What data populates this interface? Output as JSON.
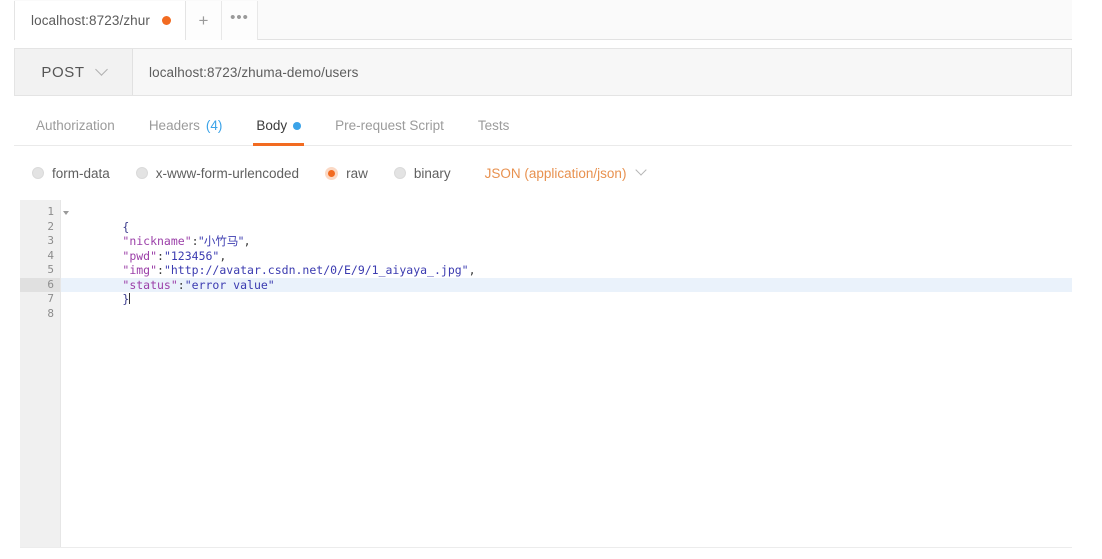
{
  "tabstrip": {
    "request_tab_label": "localhost:8723/zhur",
    "unsaved_indicator": "unsaved-dot",
    "new_tab_glyph": "+",
    "more_glyph": "•••"
  },
  "urlbar": {
    "method": "POST",
    "method_chevron": "chevron-down-icon",
    "url": "localhost:8723/zhuma-demo/users"
  },
  "section_tabs": [
    {
      "label": "Authorization",
      "active": false
    },
    {
      "label": "Headers",
      "count": "(4)",
      "active": false
    },
    {
      "label": "Body",
      "active": true,
      "dot": "blue"
    },
    {
      "label": "Pre-request Script",
      "active": false
    },
    {
      "label": "Tests",
      "active": false
    }
  ],
  "body_types": [
    {
      "label": "form-data",
      "selected": false
    },
    {
      "label": "x-www-form-urlencoded",
      "selected": false
    },
    {
      "label": "raw",
      "selected": true
    },
    {
      "label": "binary",
      "selected": false
    }
  ],
  "mime": {
    "label": "JSON (application/json)",
    "chevron": "chevron-down-icon"
  },
  "editor": {
    "gutter": [
      "1",
      "2",
      "3",
      "4",
      "5",
      "6",
      "7",
      "8"
    ],
    "active_line": 6,
    "lines": [
      {
        "n": 1,
        "open": "{"
      },
      {
        "n": 2,
        "key": "\"nickname\"",
        "colon": ":",
        "value": "\"小竹马\"",
        "comma": ","
      },
      {
        "n": 3,
        "key": "\"pwd\"",
        "colon": ":",
        "value": "\"123456\"",
        "comma": ","
      },
      {
        "n": 4,
        "key": "\"img\"",
        "colon": ":",
        "value": "\"http://avatar.csdn.net/0/E/9/1_aiyaya_.jpg\"",
        "comma": ","
      },
      {
        "n": 5,
        "key": "\"status\"",
        "colon": ":",
        "value": "\"error value\"",
        "comma": ""
      },
      {
        "n": 6,
        "close": "}"
      }
    ]
  },
  "colors": {
    "accent_orange": "#f26b21",
    "accent_blue": "#3ba3e8",
    "mime_orange": "#e8914f",
    "json_key": "#9b3fa8",
    "json_string": "#3b3bb0",
    "gutter_bg": "#f0f0f0",
    "active_line_bg": "#eaf2fb"
  }
}
